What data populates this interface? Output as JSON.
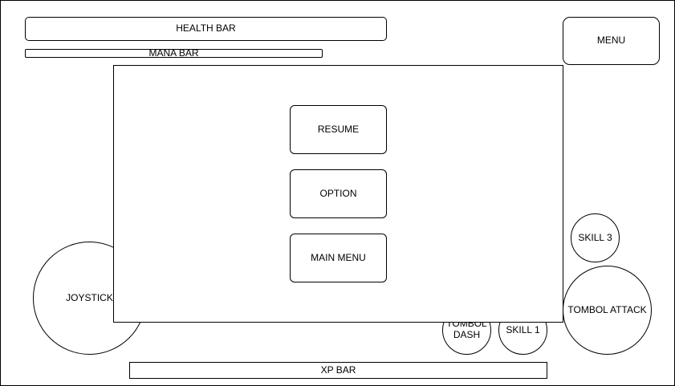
{
  "hud": {
    "health_bar": "HEALTH BAR",
    "mana_bar": "MANA BAR",
    "menu": "MENU",
    "joystick": "JOYSTICK",
    "tombol_dash": "TOMBOL DASH",
    "skill_1": "SKILL 1",
    "skill_3": "SKILL 3",
    "tombol_attack": "TOMBOL ATTACK",
    "xp_bar": "XP BAR"
  },
  "pause_menu": {
    "resume": "RESUME",
    "option": "OPTION",
    "main_menu": "MAIN MENU"
  },
  "colors": {
    "stroke": "#000000",
    "fill": "#ffffff"
  }
}
